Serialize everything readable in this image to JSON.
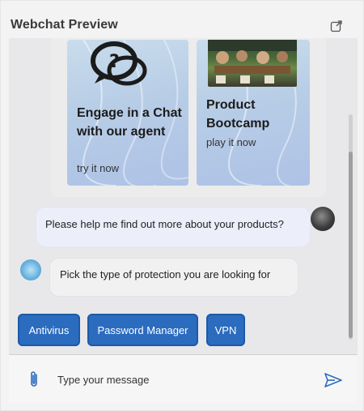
{
  "header": {
    "title": "Webchat Preview",
    "popout_icon": "popout-icon"
  },
  "carousel": {
    "cards": [
      {
        "title": "Engage in a Chat with our agent",
        "link": "try it now",
        "icon": "chat-bubbles-icon"
      },
      {
        "title": "Product Bootcamp",
        "link": "play it now",
        "image": "bootcamp-photo"
      }
    ]
  },
  "messages": {
    "user": {
      "text": "Please help me find out more about your products?"
    },
    "bot": {
      "text": "Pick the type of protection you are looking for"
    }
  },
  "quick_replies": [
    "Antivirus",
    "Password Manager",
    "VPN"
  ],
  "composer": {
    "placeholder": "Type your message",
    "attach_icon": "paperclip-icon",
    "send_icon": "send-icon"
  },
  "colors": {
    "accent": "#2c6cbf",
    "panel_bg": "#f3f3f3",
    "chat_bg": "#e8e8ea"
  }
}
